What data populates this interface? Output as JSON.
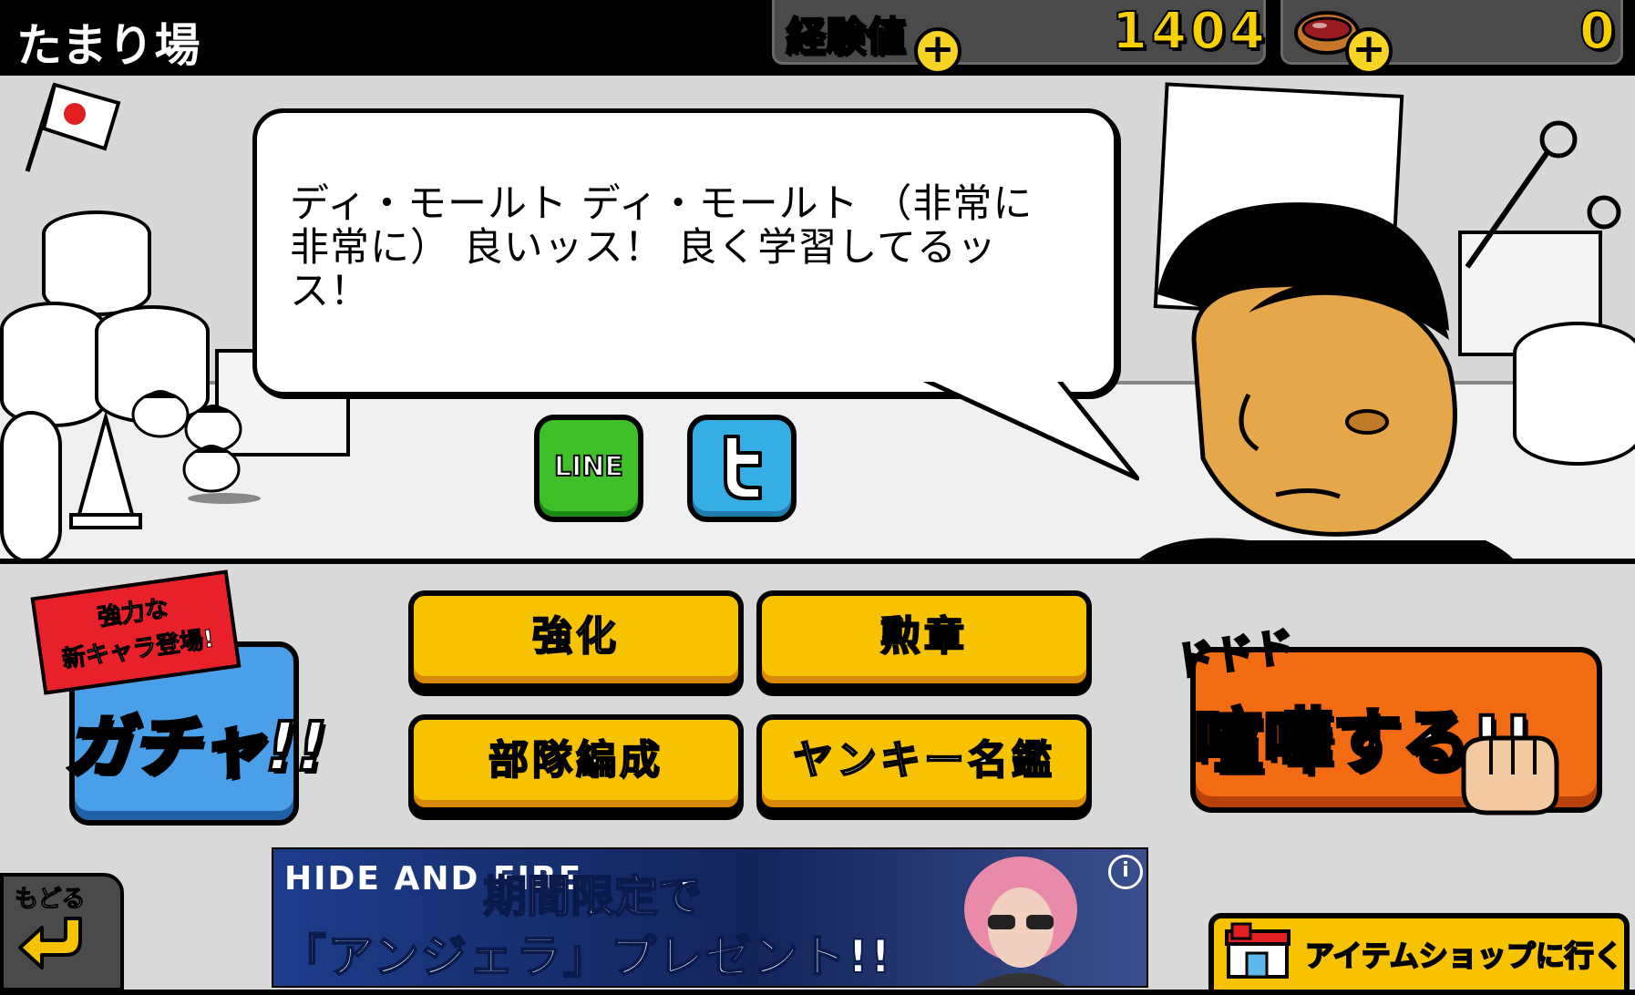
{
  "header": {
    "title": "たまり場",
    "exp_label": "経験値",
    "exp_value": "1404",
    "bun_value": "0"
  },
  "dialog": {
    "text": "ディ・モールト ディ・モールト （非常に 非常に） 良いッス！ 良く学習してるッス！"
  },
  "share": {
    "line_label": "LINE",
    "twitter_icon": "twitter-bird-icon"
  },
  "menu": {
    "upgrade": "強化",
    "medal": "勲章",
    "squad": "部隊編成",
    "yankee_book": "ヤンキー名鑑"
  },
  "gacha": {
    "banner_line1": "強力な",
    "banner_line2": "新キャラ登場!",
    "label": "ガチャ!!"
  },
  "fight": {
    "sfx": "ドドド",
    "label": "喧嘩する!!"
  },
  "back": {
    "label": "もどる"
  },
  "ad": {
    "brand": "HIDE AND FIRE",
    "line1": "期間限定で",
    "line2": "「アンジェラ」プレゼント!!",
    "info": "i"
  },
  "shop": {
    "label": "アイテムショップに行く"
  },
  "colors": {
    "accent_yellow": "#f7c300",
    "fight_orange": "#f36b12",
    "exp_purple": "#c98be8",
    "line_green": "#3fc028",
    "twitter_blue": "#35aee5"
  }
}
